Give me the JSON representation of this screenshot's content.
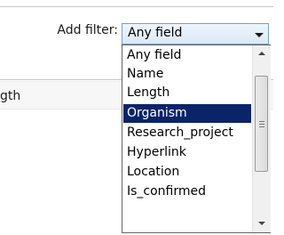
{
  "filter": {
    "label": "Add filter:",
    "selected_value": "Any field"
  },
  "table": {
    "partial_column_header": "gth"
  },
  "dropdown": {
    "options": [
      {
        "label": "Any field"
      },
      {
        "label": "Name"
      },
      {
        "label": "Length"
      },
      {
        "label": "Organism",
        "highlighted": true
      },
      {
        "label": "Research_project"
      },
      {
        "label": "Hyperlink"
      },
      {
        "label": "Location"
      },
      {
        "label": "Is_confirmed"
      }
    ],
    "highlight_color": "#0a246a"
  },
  "icons": {
    "combo_arrow": "chevron-down-icon",
    "scroll_up": "arrow-up-icon",
    "scroll_down": "arrow-down-icon"
  }
}
